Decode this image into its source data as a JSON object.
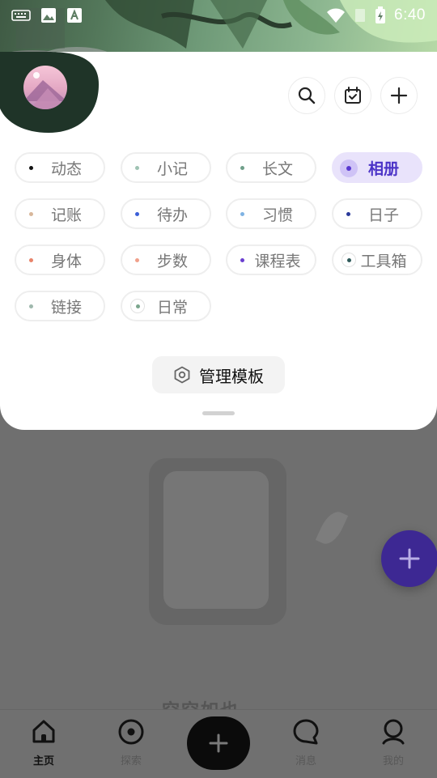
{
  "status_bar": {
    "time": "6:40",
    "left_icons": [
      "keyboard-icon",
      "image-icon",
      "text-recognition-icon"
    ],
    "right_icons": [
      "wifi-icon",
      "signal-icon",
      "battery-charging-icon"
    ]
  },
  "header": {
    "avatar": "avatar-mountain",
    "actions": [
      {
        "name": "search-icon"
      },
      {
        "name": "calendar-check-icon"
      },
      {
        "name": "plus-icon"
      }
    ]
  },
  "templates": [
    {
      "label": "动态",
      "color": "#111111",
      "active": false
    },
    {
      "label": "小记",
      "color": "#9fc3b3",
      "active": false
    },
    {
      "label": "长文",
      "color": "#6f9f8a",
      "active": false
    },
    {
      "label": "相册",
      "color": "#5838d0",
      "active": true
    },
    {
      "label": "记账",
      "color": "#d8b79a",
      "active": false
    },
    {
      "label": "待办",
      "color": "#3b5fd8",
      "active": false
    },
    {
      "label": "习惯",
      "color": "#7fb3e3",
      "active": false
    },
    {
      "label": "日子",
      "color": "#2a3a9a",
      "active": false
    },
    {
      "label": "身体",
      "color": "#e8836a",
      "active": false
    },
    {
      "label": "步数",
      "color": "#f0a08a",
      "active": false
    },
    {
      "label": "课程表",
      "color": "#6a3fd0",
      "active": false
    },
    {
      "label": "工具箱",
      "color": "#2f5a5a",
      "active": false,
      "ring": true
    },
    {
      "label": "链接",
      "color": "#9fb8ad",
      "active": false
    },
    {
      "label": "日常",
      "color": "#7aa58c",
      "active": false,
      "ring": true
    }
  ],
  "manage_button": {
    "label": "管理模板",
    "icon": "hexagon-settings-icon"
  },
  "background": {
    "empty_state_text": "空空如也",
    "fab_icon": "plus-icon"
  },
  "bottom_nav": {
    "items": [
      {
        "label": "主页",
        "icon": "home-icon",
        "active": true
      },
      {
        "label": "探索",
        "icon": "compass-icon",
        "active": false
      },
      {
        "label": "",
        "icon": "plus-icon",
        "center": true
      },
      {
        "label": "消息",
        "icon": "message-icon",
        "active": false
      },
      {
        "label": "我的",
        "icon": "profile-icon",
        "active": false
      }
    ]
  },
  "colors": {
    "accent": "#5838d0",
    "accent_soft": "#e9e3fb",
    "fab": "#3d2893",
    "scrim": "#6f6f6f"
  }
}
